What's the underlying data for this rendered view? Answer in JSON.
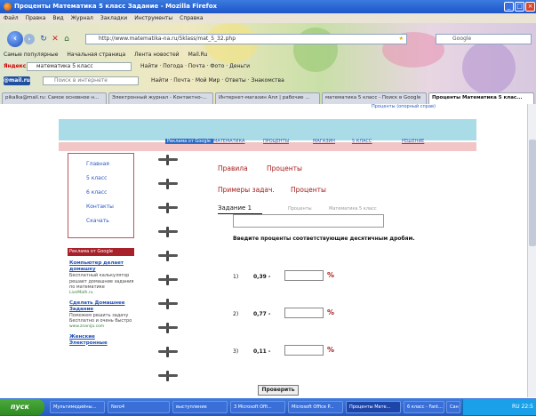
{
  "window": {
    "title": "Проценты Математика 5 класс Задание - Mozilla Firefox",
    "controls": {
      "minimize": "_",
      "maximize": "□",
      "close": "×"
    }
  },
  "menu": [
    "Файл",
    "Правка",
    "Вид",
    "Журнал",
    "Закладки",
    "Инструменты",
    "Справка"
  ],
  "nav": {
    "url": "http://www.matematika-na.ru/5klass/mat_5_32.php",
    "search_placeholder": "Google",
    "back_icon": "back-arrow-icon",
    "forward_icon": "forward-arrow-icon"
  },
  "bookmarks": [
    "Самые популярные",
    "Начальная страница",
    "Лента новостей",
    "Mail.Ru"
  ],
  "yandex": {
    "label": "Яндекс",
    "query": "математика 5 класс",
    "items": "Найти · Погода · Почта · Фото · Деньги"
  },
  "mailru": {
    "logo": "@mail.ru",
    "placeholder": "Поиск в интернете",
    "items": "Найти · Почта · Мой Мир · Ответы · Знакомства"
  },
  "tabs": [
    "pikalka@mail.ru: Самое основное н...",
    "Электронный журнал - Контактно-...",
    "Интернет-магазин Алл | рабочие ...",
    "математика 5 класс - Поиск в Google",
    "Проценты Математика 5 клас..."
  ],
  "page": {
    "top_link": "Проценты (опорный справ)",
    "topnav": [
      "Реклама от Google",
      "МАТЕМАТИКА",
      "ПРОЦЕНТЫ",
      "МАГАЗИН",
      "5 КЛАСС",
      "РЕШЕНИЕ"
    ],
    "sidebar": [
      "Главная",
      "5 класс",
      "6 класс",
      "Контакты",
      "Скачать"
    ],
    "ads": {
      "header": "Реклама от Google",
      "items": [
        {
          "title": "Компьютер делает домашку",
          "text": "Бесплатный калькулятор решает домашние задания по математике",
          "url": "LiveMath.ru"
        },
        {
          "title": "Сделать Домашнее Задание",
          "text": "Поможем решить задачу Бесплатно и очень быстро",
          "url": "www.znanija.com"
        },
        {
          "title": "Женские Электронные",
          "text": "",
          "url": ""
        }
      ]
    },
    "rules_label": "Правила",
    "rules_topic": "Проценты",
    "examples_label": "Примеры задач.",
    "examples_topic": "Проценты",
    "task_title": "Задание 1",
    "tab_grey1": "Проценты",
    "tab_grey2": "Математика 5 класс",
    "instruction": "Введите проценты соответствующие десятичным дробям.",
    "questions": [
      {
        "num": "1)",
        "value": "0,39 -",
        "unit": "%"
      },
      {
        "num": "2)",
        "value": "0,77 -",
        "unit": "%"
      },
      {
        "num": "3)",
        "value": "0,11 -",
        "unit": "%"
      }
    ],
    "check_button": "Проверить"
  },
  "taskbar": {
    "start": "пуск",
    "items": [
      "Мультимедийны...",
      "Nero4",
      "выступление",
      "3 Microsoft Offi...",
      "Microsoft Office P...",
      "Проценты Мате...",
      "6 класс - Fant...",
      "Сан"
    ],
    "tray": "RU 22:5"
  }
}
